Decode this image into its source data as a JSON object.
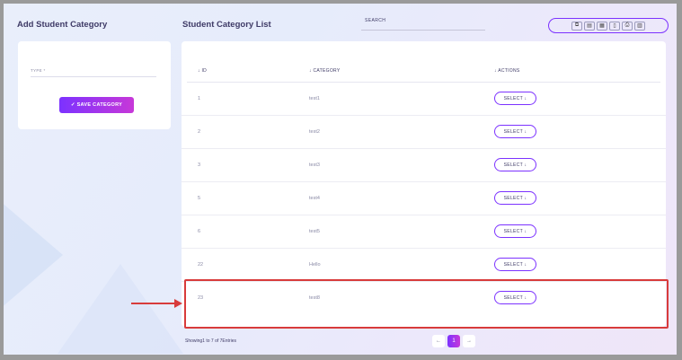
{
  "left": {
    "title": "Add Student Category",
    "type_label": "TYPE *",
    "save_label": "✓ SAVE CATEGORY"
  },
  "right": {
    "title": "Student Category List",
    "search_placeholder": "SEARCH",
    "toolbar_icons": [
      "copy-icon",
      "csv-icon",
      "excel-icon",
      "pdf-icon",
      "print-icon",
      "columns-icon"
    ],
    "headers": {
      "id": "↓ ID",
      "category": "↓ CATEGORY",
      "actions": "↓ ACTIONS"
    },
    "rows": [
      {
        "id": "1",
        "category": "test1",
        "action": "SELECT ↓"
      },
      {
        "id": "2",
        "category": "test2",
        "action": "SELECT ↓"
      },
      {
        "id": "3",
        "category": "test3",
        "action": "SELECT ↓"
      },
      {
        "id": "5",
        "category": "test4",
        "action": "SELECT ↓"
      },
      {
        "id": "6",
        "category": "test5",
        "action": "SELECT ↓"
      },
      {
        "id": "22",
        "category": "Hello",
        "action": "SELECT ↓"
      },
      {
        "id": "23",
        "category": "test8",
        "action": "SELECT ↓"
      }
    ],
    "showing": "Showing1 to 7 of 7Entries",
    "pagination": {
      "prev": "←",
      "current": "1",
      "next": "→"
    }
  },
  "colors": {
    "accent": "#7c32ff",
    "highlight": "#d83b3b"
  }
}
